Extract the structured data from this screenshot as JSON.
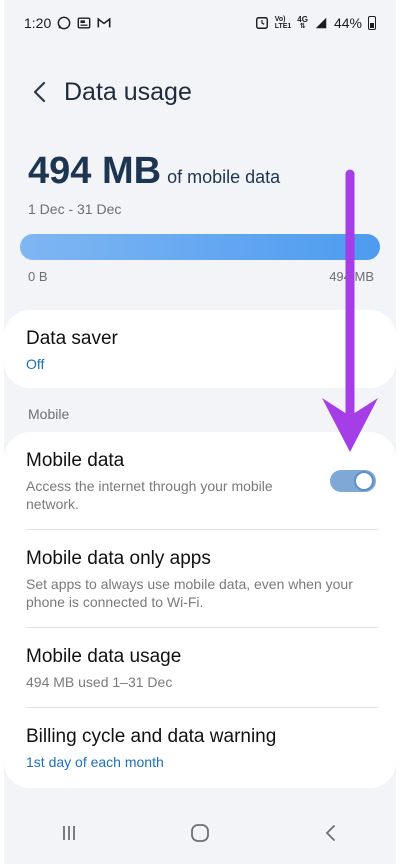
{
  "status": {
    "time": "1:20",
    "network_top": "Vo)",
    "network_mid": "LTE1",
    "signal_label": "4G",
    "battery": "44%"
  },
  "header": {
    "title": "Data usage"
  },
  "usage": {
    "amount": "494 MB",
    "suffix": "of mobile data",
    "range": "1 Dec - 31 Dec",
    "bar_min": "0 B",
    "bar_max": "494 MB",
    "fill_fraction": 1.0
  },
  "data_saver": {
    "title": "Data saver",
    "value": "Off"
  },
  "section_mobile": "Mobile",
  "mobile_items": [
    {
      "title": "Mobile data",
      "subtitle": "Access the internet through your mobile network.",
      "toggle_on": true
    },
    {
      "title": "Mobile data only apps",
      "subtitle": "Set apps to always use mobile data, even when your phone is connected to Wi-Fi."
    },
    {
      "title": "Mobile data usage",
      "subtitle": "494 MB used 1–31 Dec"
    },
    {
      "title": "Billing cycle and data warning",
      "subtitle": "1st day of each month"
    }
  ],
  "colors": {
    "accent": "#1a6fc0",
    "annotation_arrow": "#a63ee8"
  }
}
